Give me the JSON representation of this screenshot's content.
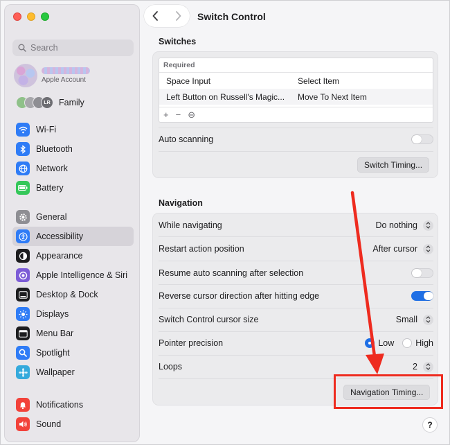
{
  "sidebar": {
    "search_placeholder": "Search",
    "account": {
      "label": "Apple Account"
    },
    "family": {
      "label": "Family",
      "avatar_initials": "LR"
    },
    "groups": [
      [
        {
          "label": "Wi-Fi",
          "icon": "wifi-icon",
          "color": "#2f7cf6"
        },
        {
          "label": "Bluetooth",
          "icon": "bluetooth-icon",
          "color": "#2f7cf6"
        },
        {
          "label": "Network",
          "icon": "globe-icon",
          "color": "#2f7cf6"
        },
        {
          "label": "Battery",
          "icon": "battery-icon",
          "color": "#34c759"
        }
      ],
      [
        {
          "label": "General",
          "icon": "gear-icon",
          "color": "#8e8e93"
        },
        {
          "label": "Accessibility",
          "icon": "accessibility-icon",
          "color": "#2f7cf6",
          "active": true
        },
        {
          "label": "Appearance",
          "icon": "appearance-icon",
          "color": "#1d1d1f"
        },
        {
          "label": "Apple Intelligence & Siri",
          "icon": "siri-icon",
          "color": "#7c5cd6"
        },
        {
          "label": "Desktop & Dock",
          "icon": "dock-icon",
          "color": "#1d1d1f"
        },
        {
          "label": "Displays",
          "icon": "sun-icon",
          "color": "#2f7cf6"
        },
        {
          "label": "Menu Bar",
          "icon": "menubar-icon",
          "color": "#1d1d1f"
        },
        {
          "label": "Spotlight",
          "icon": "magnifier-icon",
          "color": "#2f7cf6"
        },
        {
          "label": "Wallpaper",
          "icon": "wallpaper-icon",
          "color": "#35aadc"
        }
      ],
      [
        {
          "label": "Notifications",
          "icon": "bell-icon",
          "color": "#f2423a"
        },
        {
          "label": "Sound",
          "icon": "speaker-icon",
          "color": "#f2423a"
        }
      ]
    ]
  },
  "main": {
    "title": "Switch Control",
    "switches": {
      "section_title": "Switches",
      "table_header": "Required",
      "rows": [
        {
          "switch": "Space Input",
          "action": "Select Item"
        },
        {
          "switch": "Left Button on Russell's Magic...",
          "action": "Move To Next Item"
        }
      ],
      "footer_buttons": [
        "+",
        "−",
        "⊖"
      ],
      "auto_scanning_label": "Auto scanning",
      "auto_scanning_on": false,
      "timing_button": "Switch Timing..."
    },
    "navigation": {
      "section_title": "Navigation",
      "while_navigating": {
        "label": "While navigating",
        "value": "Do nothing"
      },
      "restart_action": {
        "label": "Restart action position",
        "value": "After cursor"
      },
      "resume_scanning": {
        "label": "Resume auto scanning after selection",
        "on": false
      },
      "reverse_cursor": {
        "label": "Reverse cursor direction after hitting edge",
        "on": true
      },
      "cursor_size": {
        "label": "Switch Control cursor size",
        "value": "Small"
      },
      "pointer_precision": {
        "label": "Pointer precision",
        "option_low": "Low",
        "option_high": "High",
        "selected": "Low"
      },
      "loops": {
        "label": "Loops",
        "value": "2"
      },
      "timing_button": "Navigation Timing..."
    },
    "help_label": "?"
  },
  "colors": {
    "accent": "#1f6fe5",
    "annotation": "#ee2b1f"
  }
}
